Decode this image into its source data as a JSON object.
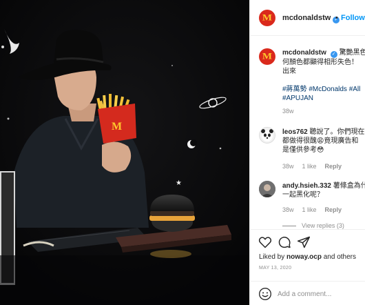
{
  "post": {
    "photo_label": "Man in black hat holding McDonald's fries and a black burger",
    "account": {
      "username": "mcdonaldstw",
      "verified_mark": "✓",
      "separator": "•",
      "follow_label": "Follow",
      "avatar_glyph": "M",
      "brand_color": "#da291c",
      "logo_color": "#ffc72c"
    },
    "caption": {
      "username": "mcdonaldstw",
      "text_line1": "驚艷黑色",
      "text_line2": "何顏色都顯得相形失色！",
      "text_line3": "出來",
      "hashtags_line1": "#蔣萬勢 #McDonalds #All",
      "hashtags_line2": "#APUJAN",
      "time": "38w"
    },
    "comments": [
      {
        "username": "leos762",
        "text_line1": "聽說了。你們現在",
        "text_line2": "都做得很醜😩竟現廣告和",
        "text_line3": "是僅供參考😳",
        "time": "38w",
        "likes": "1 like",
        "reply": "Reply"
      },
      {
        "username": "andy.hsieh.332",
        "text_line1": "薯條盒為什",
        "text_line2": "一起黑化呢？",
        "time": "38w",
        "likes": "1 like",
        "reply": "Reply",
        "view_replies": "View replies (3)"
      }
    ],
    "liked_by": {
      "prefix": "Liked by ",
      "user": "noway.ocp",
      "suffix": " and others"
    },
    "date": "MAY 13, 2020",
    "add_comment_placeholder": "Add a comment..."
  }
}
